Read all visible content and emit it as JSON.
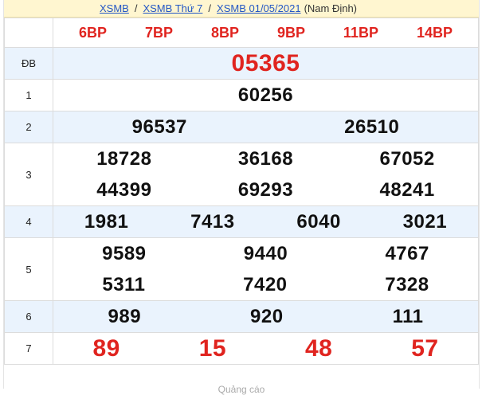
{
  "breadcrumb": {
    "link1": "XSMB",
    "link2": "XSMB Thứ 7",
    "link3": "XSMB 01/05/2021",
    "place": "(Nam Định)",
    "sep": "/"
  },
  "codes": [
    "6BP",
    "7BP",
    "8BP",
    "9BP",
    "11BP",
    "14BP"
  ],
  "prizes": [
    {
      "label": "ĐB",
      "rows": [
        [
          "05365"
        ]
      ]
    },
    {
      "label": "1",
      "rows": [
        [
          "60256"
        ]
      ]
    },
    {
      "label": "2",
      "rows": [
        [
          "96537",
          "26510"
        ]
      ]
    },
    {
      "label": "3",
      "rows": [
        [
          "18728",
          "36168",
          "67052"
        ],
        [
          "44399",
          "69293",
          "48241"
        ]
      ]
    },
    {
      "label": "4",
      "rows": [
        [
          "1981",
          "7413",
          "6040",
          "3021"
        ]
      ]
    },
    {
      "label": "5",
      "rows": [
        [
          "9589",
          "9440",
          "4767"
        ],
        [
          "5311",
          "7420",
          "7328"
        ]
      ]
    },
    {
      "label": "6",
      "rows": [
        [
          "989",
          "920",
          "111"
        ]
      ]
    },
    {
      "label": "7",
      "rows": [
        [
          "89",
          "15",
          "48",
          "57"
        ]
      ]
    }
  ],
  "footer": "Quảng cáo"
}
